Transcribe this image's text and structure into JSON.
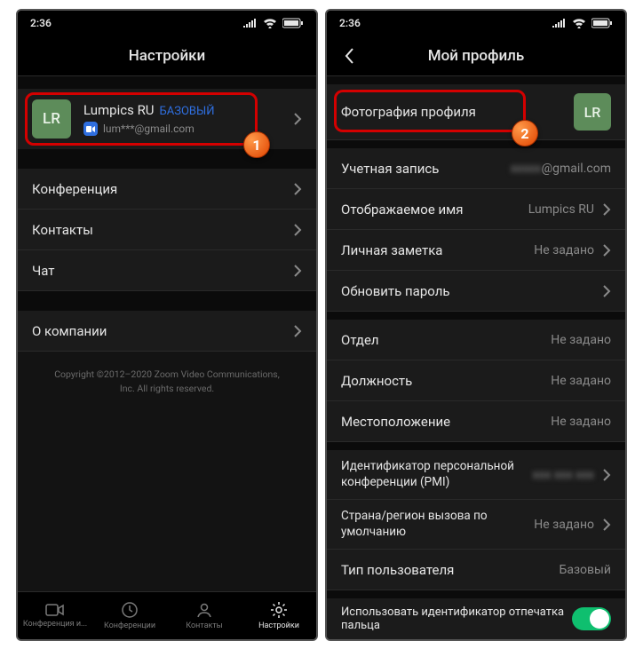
{
  "status": {
    "time": "2:36"
  },
  "left": {
    "title": "Настройки",
    "profile": {
      "initials": "LR",
      "name": "Lumpics RU",
      "badge": "БАЗОВЫЙ",
      "email": "lum***@gmail.com"
    },
    "rows": {
      "conference": "Конференция",
      "contacts": "Контакты",
      "chat": "Чат",
      "about": "О компании"
    },
    "copyright": "Copyright ©2012–2020 Zoom Video Communications, Inc. All rights reserved.",
    "nav": {
      "meet": "Конференция и...",
      "conf": "Конференции",
      "contacts": "Контакты",
      "settings": "Настройки"
    }
  },
  "right": {
    "title": "Мой профиль",
    "photo": {
      "label": "Фотография профиля",
      "initials": "LR"
    },
    "rows": {
      "account": {
        "label": "Учетная запись",
        "value": "@gmail.com"
      },
      "display_name": {
        "label": "Отображаемое имя",
        "value": "Lumpics RU"
      },
      "note": {
        "label": "Личная заметка",
        "value": "Не задано"
      },
      "password": {
        "label": "Обновить пароль"
      },
      "dept": {
        "label": "Отдел",
        "value": "Не задано"
      },
      "title": {
        "label": "Должность",
        "value": "Не задано"
      },
      "location": {
        "label": "Местоположение",
        "value": "Не задано"
      },
      "pmi": {
        "label": "Идентификатор персональной конференции (PMI)",
        "value": ""
      },
      "region": {
        "label": "Страна/регион вызова по умолчанию",
        "value": "Не задано"
      },
      "usertype": {
        "label": "Тип пользователя",
        "value": "Базовый"
      },
      "fingerprint": {
        "label": "Использовать идентификатор отпечатка пальца"
      }
    }
  },
  "markers": {
    "one": "1",
    "two": "2"
  }
}
